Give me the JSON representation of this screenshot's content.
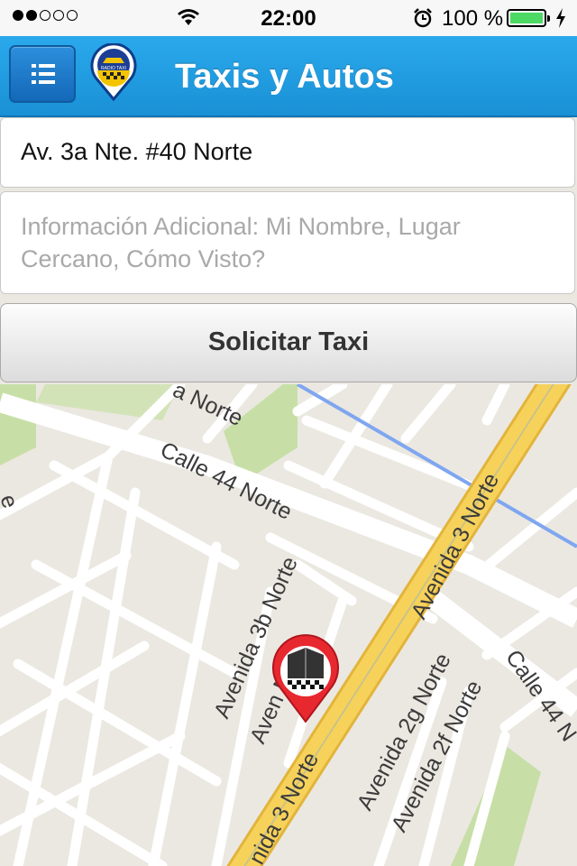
{
  "status_bar": {
    "signal_dots_filled": 2,
    "signal_dots_total": 5,
    "time": "22:00",
    "battery_percent": "100 %",
    "battery_level": 1.0,
    "icons": [
      "signal-icon",
      "wifi-icon",
      "alarm-icon",
      "battery-icon",
      "charging-bolt-icon"
    ]
  },
  "header": {
    "title": "Taxis y Autos",
    "menu_icon": "list-menu-icon",
    "logo_text": "RADIO TAXI"
  },
  "form": {
    "address_value": "Av. 3a Nte. #40 Norte",
    "info_placeholder": "Información Adicional: Mi Nombre, Lugar Cercano, Cómo Visto?",
    "request_button_label": "Solicitar Taxi"
  },
  "map": {
    "street_labels": {
      "a_norte": "a Norte",
      "calle_44_norte": "Calle 44 Norte",
      "avenida_3_norte_top": "Avenida 3 Norte",
      "avenida_3b_norte": "Avenida 3b Norte",
      "avenida_norte_partial": "Aven   Norte",
      "avenida_2g_norte": "Avenida 2g Norte",
      "avenida_2f_norte": "Avenida 2f Norte",
      "calle_44_norte_right": "Calle 44 N",
      "avenida_3_norte_bottom": "nida 3 Norte",
      "e_fragment": "e"
    },
    "marker_icon": "taxi-location-pin-icon",
    "colors": {
      "main_road": "#f7d25a",
      "road_edge": "#e2b43c",
      "park": "#c7dfa6",
      "transit": "#7fa6f0"
    }
  }
}
